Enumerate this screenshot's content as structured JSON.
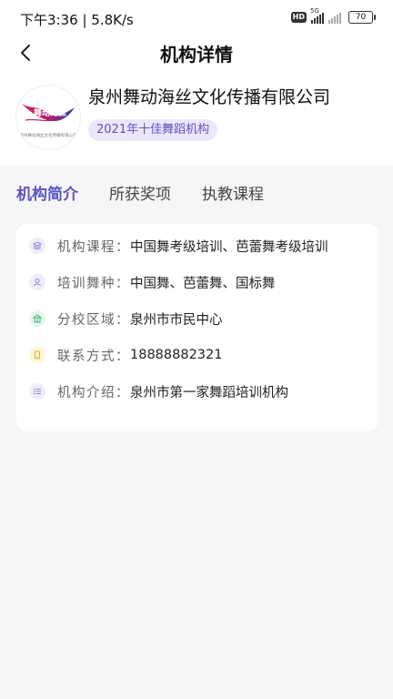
{
  "status": {
    "time": "下午3:36 | 5.8K/s",
    "network": "5G",
    "hd": "HD",
    "battery": "70"
  },
  "nav": {
    "title": "机构详情"
  },
  "org": {
    "name": "泉州舞动海丝文化传播有限公司",
    "badge": "2021年十佳舞蹈机构",
    "logo_text": "舞动海丝",
    "logo_caption": "泉州舞动海丝文化传播有限公司"
  },
  "tabs": [
    {
      "label": "机构简介",
      "active": true
    },
    {
      "label": "所获奖项",
      "active": false
    },
    {
      "label": "执教课程",
      "active": false
    }
  ],
  "info": [
    {
      "label": "机构课程：",
      "value": "中国舞考级培训、芭蕾舞考级培训",
      "icon": "layers-icon"
    },
    {
      "label": "培训舞种：",
      "value": "中国舞、芭蕾舞、国标舞",
      "icon": "user-icon"
    },
    {
      "label": "分校区域：",
      "value": "泉州市市民中心",
      "icon": "building-icon"
    },
    {
      "label": "联系方式：",
      "value": "18888882321",
      "icon": "phone-icon"
    },
    {
      "label": "机构介绍：",
      "value": "泉州市第一家舞蹈培训机构",
      "icon": "list-icon"
    }
  ],
  "colors": {
    "accent": "#5b52c7",
    "badge_bg": "#ebe8fb",
    "icon_bg": "#efedfb",
    "page_bg": "#f6f6f8"
  }
}
